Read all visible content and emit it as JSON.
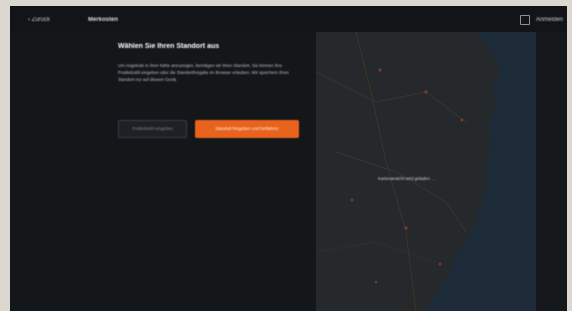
{
  "topbar": {
    "back_label": "‹ Zurück",
    "brand": "Merkosten",
    "login_label": "Anmelden"
  },
  "panel": {
    "title": "Wählen Sie Ihren Standort aus",
    "description": "Um Angebote in Ihrer Nähe anzuzeigen, benötigen wir Ihren Standort. Sie können Ihre Postleitzahl eingeben oder die Standortfreigabe im Browser erlauben. Wir speichern Ihren Standort nur auf diesem Gerät.",
    "secondary_button": "Postleitzahl eingeben",
    "primary_button": "Standort freigeben und fortfahren"
  },
  "map": {
    "label": "Kartenansicht wird geladen …"
  },
  "colors": {
    "accent": "#e8631c",
    "background": "#14171a",
    "map_land": "#26292b",
    "map_water": "#1e2b38"
  }
}
